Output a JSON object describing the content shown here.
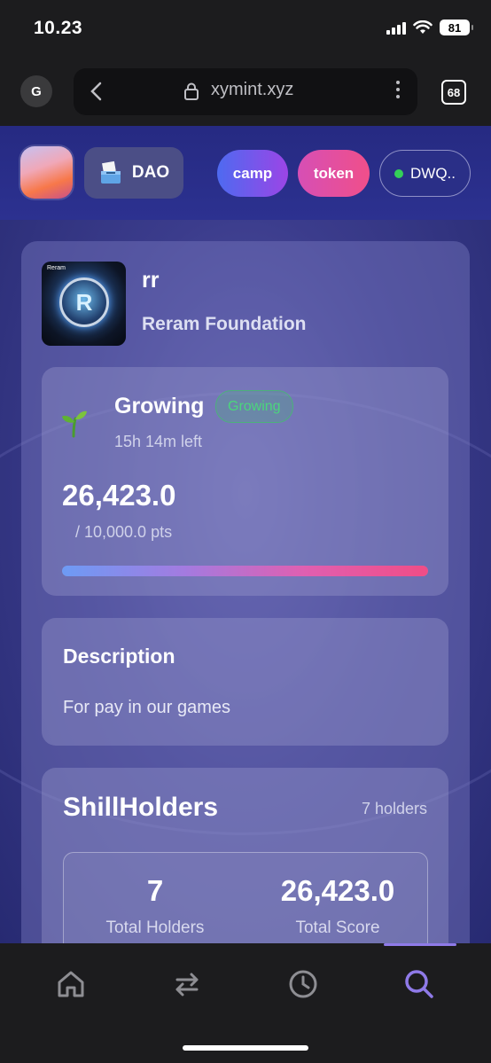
{
  "status_bar": {
    "time": "10.23",
    "battery": "81"
  },
  "browser": {
    "account_initial": "G",
    "url": "xymint.xyz",
    "tab_count": "68"
  },
  "header": {
    "dao_label": "DAO",
    "camp_label": "camp",
    "token_label": "token",
    "wallet_label": "DWQ..",
    "colors": {
      "camp": "#4e6af0",
      "token": "#f04f8a",
      "wallet_status": "#34d058"
    }
  },
  "token": {
    "name": "rr",
    "organization": "Reram Foundation",
    "image_text": "R",
    "image_brand": "Reram"
  },
  "phase": {
    "title": "Growing",
    "badge": "Growing",
    "time_left": "15h 14m left",
    "score": "26,423.0",
    "score_max": "/ 10,000.0 pts",
    "progress_fraction": 1.0
  },
  "description": {
    "title": "Description",
    "text": "For pay in our games"
  },
  "shill_holders": {
    "title": "ShillHolders",
    "count_label": "7 holders",
    "total_holders_value": "7",
    "total_holders_label": "Total Holders",
    "total_score_value": "26,423.0",
    "total_score_label": "Total Score"
  },
  "bottom_nav": {
    "items": [
      {
        "icon": "home-icon"
      },
      {
        "icon": "swap-icon"
      },
      {
        "icon": "history-icon"
      },
      {
        "icon": "search-icon",
        "active": true
      }
    ],
    "active_color": "#8f7ae8"
  }
}
